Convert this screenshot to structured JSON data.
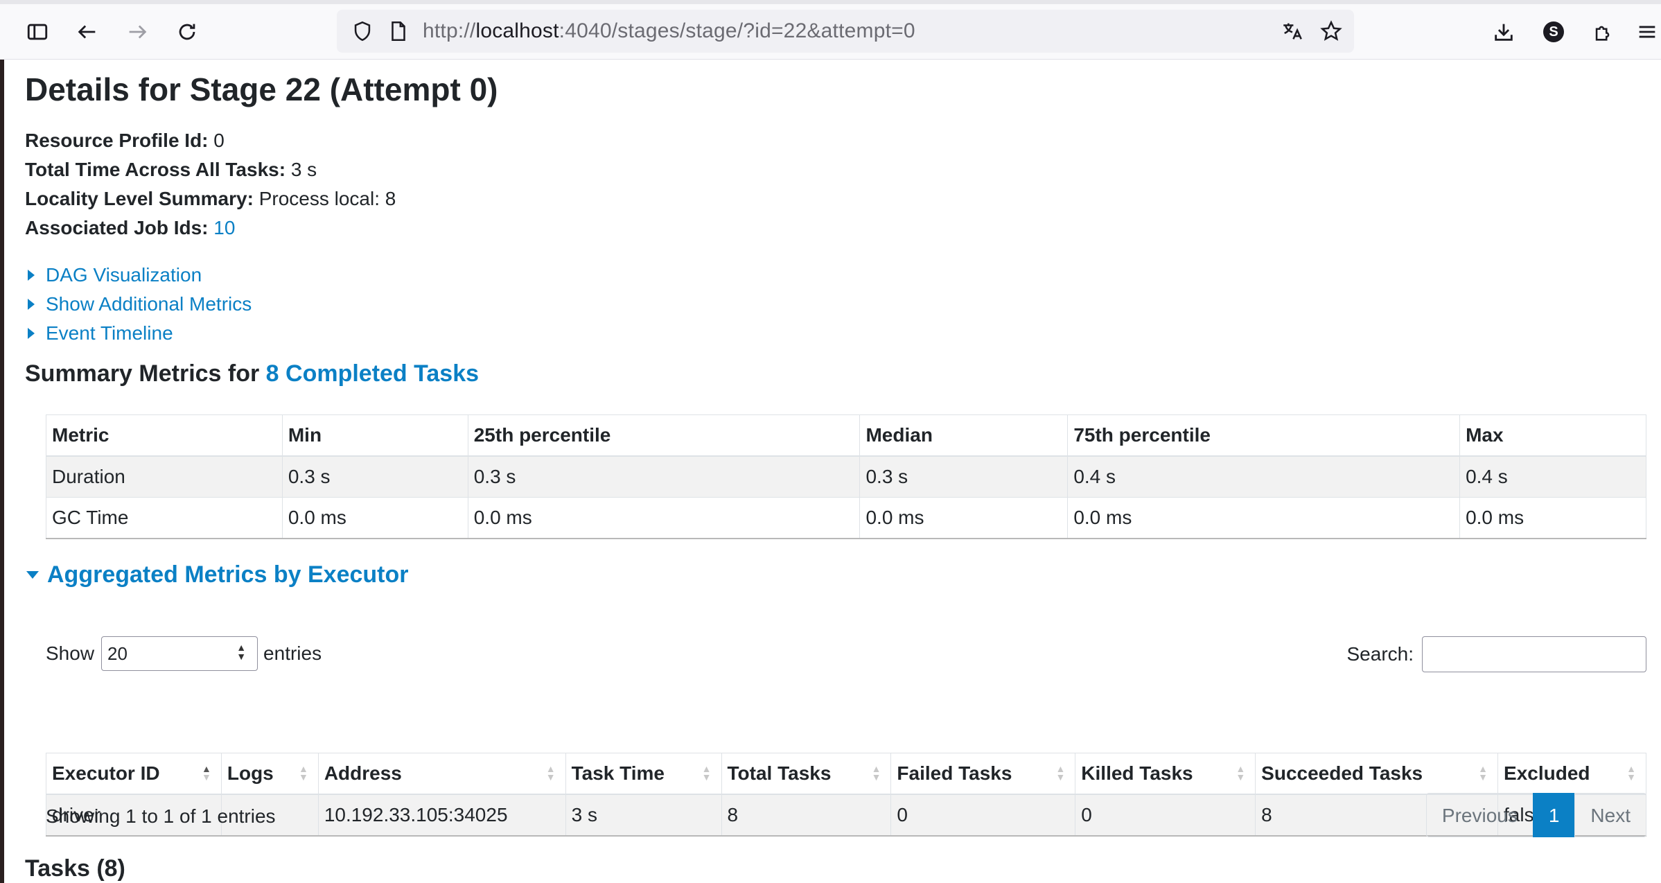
{
  "browser": {
    "url_prefix": "http://",
    "url_host": "localhost",
    "url_rest": ":4040/stages/stage/?id=22&attempt=0",
    "profile_initial": "S"
  },
  "page": {
    "title": "Details for Stage 22 (Attempt 0)",
    "info": [
      {
        "label": "Resource Profile Id:",
        "value": "0"
      },
      {
        "label": "Total Time Across All Tasks:",
        "value": "3 s"
      },
      {
        "label": "Locality Level Summary:",
        "value": "Process local: 8"
      },
      {
        "label": "Associated Job Ids:",
        "value": "10"
      }
    ],
    "toggles": [
      "DAG Visualization",
      "Show Additional Metrics",
      "Event Timeline"
    ]
  },
  "summary": {
    "heading_prefix": "Summary Metrics for ",
    "heading_link": "8 Completed Tasks",
    "columns": [
      "Metric",
      "Min",
      "25th percentile",
      "Median",
      "75th percentile",
      "Max"
    ],
    "rows": [
      [
        "Duration",
        "0.3 s",
        "0.3 s",
        "0.3 s",
        "0.4 s",
        "0.4 s"
      ],
      [
        "GC Time",
        "0.0 ms",
        "0.0 ms",
        "0.0 ms",
        "0.0 ms",
        "0.0 ms"
      ]
    ]
  },
  "aggregated": {
    "heading": "Aggregated Metrics by Executor",
    "show_label": "Show",
    "entries_value": "20",
    "entries_label": "entries",
    "search_label": "Search:",
    "search_value": "",
    "columns": [
      "Executor ID",
      "Logs",
      "Address",
      "Task Time",
      "Total Tasks",
      "Failed Tasks",
      "Killed Tasks",
      "Succeeded Tasks",
      "Excluded"
    ],
    "rows": [
      [
        "driver",
        "",
        "10.192.33.105:34025",
        "3 s",
        "8",
        "0",
        "0",
        "8",
        "false"
      ]
    ],
    "showing": "Showing 1 to 1 of 1 entries",
    "pager": {
      "previous": "Previous",
      "current": "1",
      "next": "Next"
    }
  },
  "tasks": {
    "heading": "Tasks (8)"
  }
}
